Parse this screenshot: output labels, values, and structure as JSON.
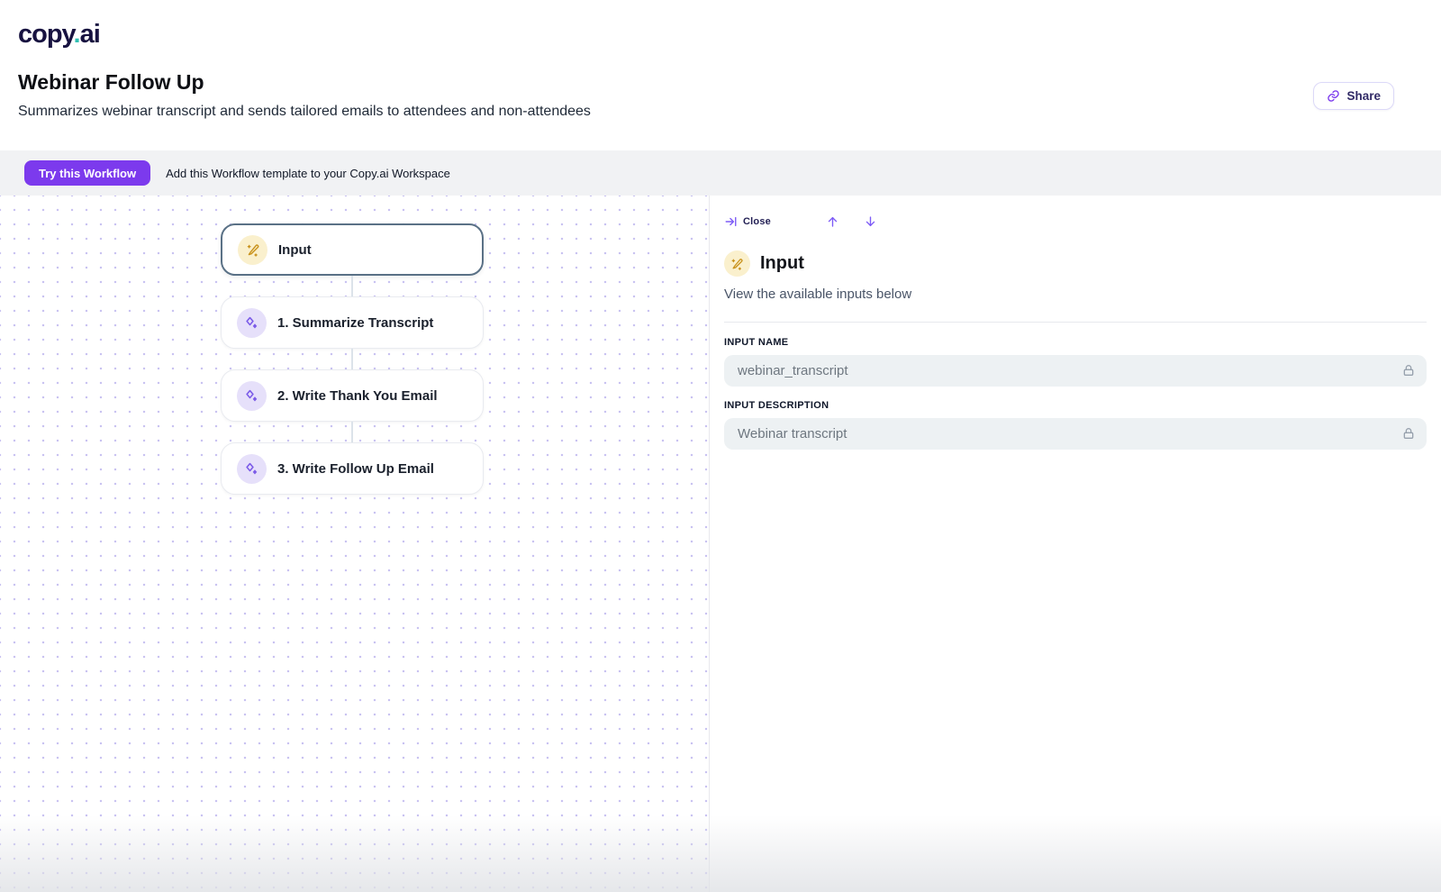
{
  "header": {
    "logo_part1": "copy",
    "logo_dot": ".",
    "logo_part2": "ai",
    "title": "Webinar Follow Up",
    "subtitle": "Summarizes webinar transcript and sends tailored emails to attendees and non-attendees",
    "share_label": "Share"
  },
  "cta": {
    "button_label": "Try this Workflow",
    "description": "Add this Workflow template to your Copy.ai Workspace"
  },
  "canvas": {
    "nodes": [
      {
        "label": "Input",
        "icon": "wand-icon",
        "selected": true
      },
      {
        "label": "1. Summarize Transcript",
        "icon": "sparkles-icon",
        "selected": false
      },
      {
        "label": "2. Write Thank You Email",
        "icon": "sparkles-icon",
        "selected": false
      },
      {
        "label": "3. Write Follow Up Email",
        "icon": "sparkles-icon",
        "selected": false
      }
    ]
  },
  "panel": {
    "close_label": "Close",
    "title": "Input",
    "description": "View the available inputs below",
    "fields": [
      {
        "label": "INPUT NAME",
        "value": "webinar_transcript",
        "locked": true
      },
      {
        "label": "INPUT DESCRIPTION",
        "value": "Webinar transcript",
        "locked": true
      }
    ]
  },
  "colors": {
    "accent_purple": "#7C3AED",
    "icon_purple": "#7D5BF6",
    "sparkle_purple": "#7C5CE8",
    "amber_icon": "#C9931D",
    "amber_circle_bg": "#FAF0CD",
    "lavender_circle_bg": "#E6E0FA",
    "selected_node_border": "#5A7186",
    "logo_navy": "#171240",
    "logo_teal": "#2FBFB2",
    "cta_bar_bg": "#F1F2F4",
    "field_bg": "#EDF1F3"
  }
}
